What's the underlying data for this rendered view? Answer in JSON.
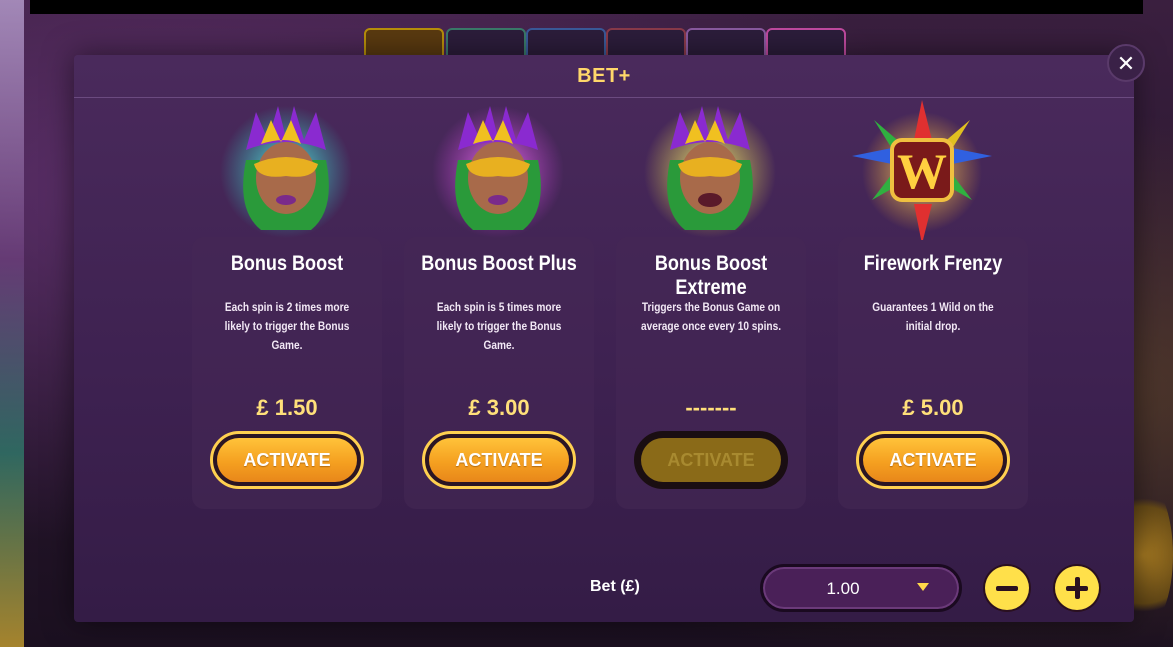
{
  "modal": {
    "title": "BET+",
    "close_icon": "close-icon"
  },
  "cards": [
    {
      "title": "Bonus Boost",
      "description": "Each spin is 2 times more likely to trigger the Bonus Game.",
      "price": "£ 1.50",
      "button_label": "ACTIVATE",
      "button_enabled": true,
      "icon": "masked-woman-icon",
      "glow_color": "#2ad0c0"
    },
    {
      "title": "Bonus Boost Plus",
      "description": "Each spin is 5 times more likely to trigger the Bonus Game.",
      "price": "£ 3.00",
      "button_label": "ACTIVATE",
      "button_enabled": true,
      "icon": "masked-woman-icon",
      "glow_color": "#d040e0"
    },
    {
      "title": "Bonus Boost Extreme",
      "description": "Triggers the Bonus Game on average once every 10 spins.",
      "price": "-------",
      "button_label": "ACTIVATE",
      "button_enabled": false,
      "icon": "masked-woman-icon",
      "glow_color": "#f0e040"
    },
    {
      "title": "Firework Frenzy",
      "description": "Guarantees 1 Wild on the initial drop.",
      "price": "£ 5.00",
      "button_label": "ACTIVATE",
      "button_enabled": true,
      "icon": "wild-firework-icon",
      "glow_color": "#ffb020"
    }
  ],
  "bet": {
    "label": "Bet (£)",
    "value": "1.00"
  },
  "colors": {
    "accent": "#ffd76a",
    "button": "#f5a020",
    "modal_bg": "#3d2150"
  }
}
